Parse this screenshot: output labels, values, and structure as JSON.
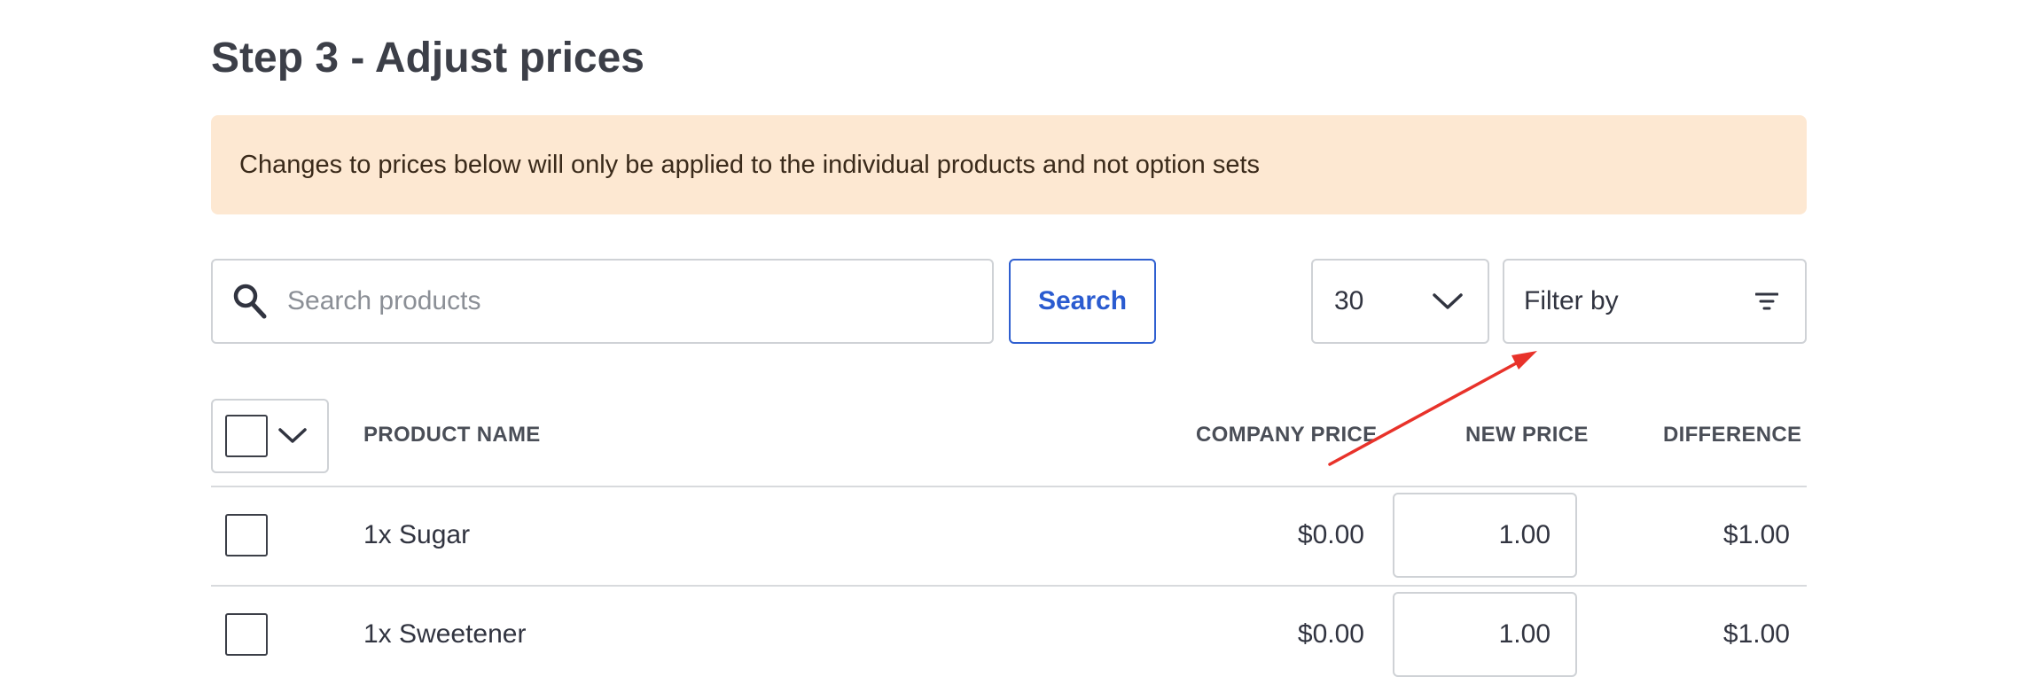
{
  "page": {
    "title": "Step 3 - Adjust prices",
    "notice": "Changes to prices below will only be applied to the individual products and not option sets"
  },
  "toolbar": {
    "search_placeholder": "Search products",
    "search_value": "",
    "search_button": "Search",
    "page_size": "30",
    "filter_label": "Filter by"
  },
  "table": {
    "columns": {
      "product_name": "PRODUCT NAME",
      "company_price": "COMPANY PRICE",
      "new_price": "NEW PRICE",
      "difference": "DIFFERENCE"
    },
    "rows": [
      {
        "name": "1x Sugar",
        "company_price": "$0.00",
        "new_price": "1.00",
        "difference": "$1.00"
      },
      {
        "name": "1x Sweetener",
        "company_price": "$0.00",
        "new_price": "1.00",
        "difference": "$1.00"
      }
    ]
  },
  "annotation": {
    "arrow_color": "#e8322a"
  },
  "icons": {
    "search": "search-icon",
    "page_size_chevron": "chevron-down-icon",
    "filter": "filter-icon",
    "select_chevron": "chevron-down-icon"
  }
}
